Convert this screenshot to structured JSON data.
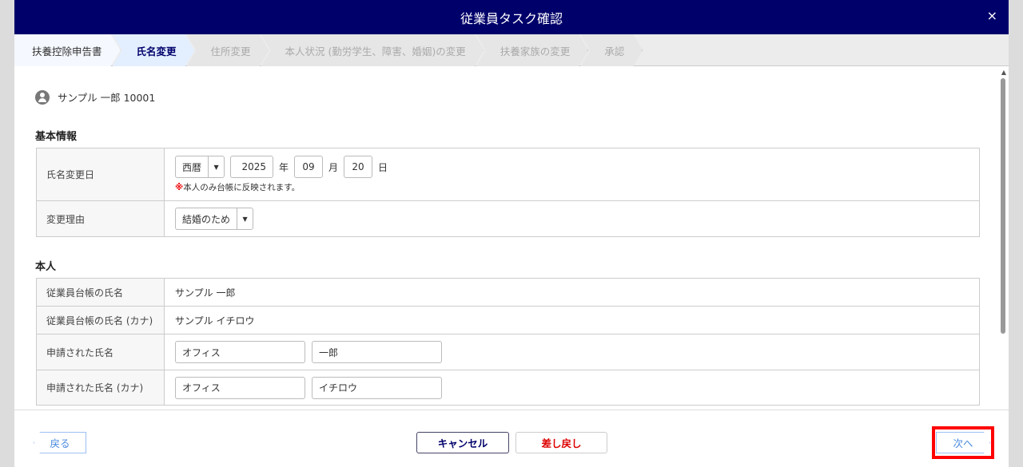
{
  "header": {
    "title": "従業員タスク確認",
    "close": "×"
  },
  "steps": [
    "扶養控除申告書",
    "氏名変更",
    "住所変更",
    "本人状況 (勤労学生、障害、婚姻)の変更",
    "扶養家族の変更",
    "承認"
  ],
  "active_step": 1,
  "user": {
    "name": "サンプル 一郎 10001"
  },
  "basic": {
    "title": "基本情報",
    "date_label": "氏名変更日",
    "era": "西暦",
    "year": "2025",
    "year_unit": "年",
    "month": "09",
    "month_unit": "月",
    "day": "20",
    "day_unit": "日",
    "note_mark": "※",
    "note": "本人のみ台帳に反映されます。",
    "reason_label": "変更理由",
    "reason": "結婚のため"
  },
  "person": {
    "title": "本人",
    "rows": [
      {
        "label": "従業員台帳の氏名",
        "value": "サンプル 一郎"
      },
      {
        "label": "従業員台帳の氏名 (カナ)",
        "value": "サンプル イチロウ"
      }
    ],
    "requested_label": "申請された氏名",
    "requested_last": "オフィス",
    "requested_first": "一郎",
    "requested_kana_label": "申請された氏名 (カナ)",
    "requested_kana_last": "オフィス",
    "requested_kana_first": "イチロウ"
  },
  "footer": {
    "back": "戻る",
    "cancel": "キャンセル",
    "return": "差し戻し",
    "next": "次へ"
  }
}
